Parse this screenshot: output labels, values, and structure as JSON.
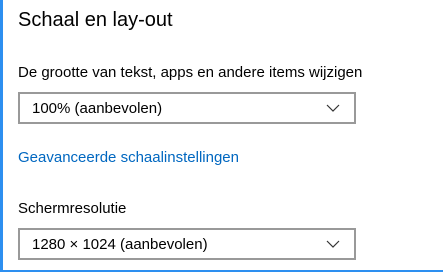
{
  "section": {
    "title": "Schaal en lay-out"
  },
  "scale": {
    "label": "De grootte van tekst, apps en andere items wijzigen",
    "selected": "100% (aanbevolen)",
    "icon": "chevron-down-icon"
  },
  "advanced_link": {
    "label": "Geavanceerde schaalinstellingen"
  },
  "resolution": {
    "label": "Schermresolutie",
    "selected": "1280 × 1024 (aanbevolen)",
    "icon": "chevron-down-icon"
  },
  "colors": {
    "accent": "#2d8ff0",
    "link": "#0067c0",
    "dropdown_border": "#999999"
  }
}
